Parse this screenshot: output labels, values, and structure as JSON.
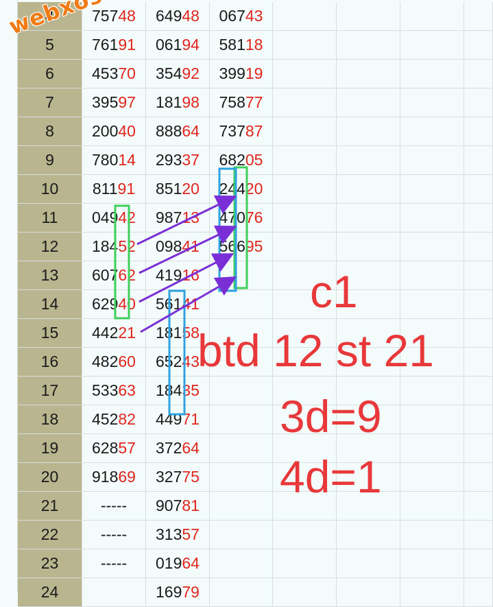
{
  "table": {
    "rows": [
      {
        "index": "4",
        "c1": "75748",
        "c2": "64948",
        "c3": "06743"
      },
      {
        "index": "5",
        "c1": "76191",
        "c2": "06194",
        "c3": "58118"
      },
      {
        "index": "6",
        "c1": "45370",
        "c2": "35492",
        "c3": "39919"
      },
      {
        "index": "7",
        "c1": "39597",
        "c2": "18198",
        "c3": "75877"
      },
      {
        "index": "8",
        "c1": "20040",
        "c2": "88864",
        "c3": "73787"
      },
      {
        "index": "9",
        "c1": "78014",
        "c2": "29337",
        "c3": "68205"
      },
      {
        "index": "10",
        "c1": "81191",
        "c2": "85120",
        "c3": "24420"
      },
      {
        "index": "11",
        "c1": "04942",
        "c2": "98713",
        "c3": "47076"
      },
      {
        "index": "12",
        "c1": "18452",
        "c2": "09841",
        "c3": "56695"
      },
      {
        "index": "13",
        "c1": "60762",
        "c2": "41916",
        "c3": ""
      },
      {
        "index": "14",
        "c1": "62940",
        "c2": "56141",
        "c3": ""
      },
      {
        "index": "15",
        "c1": "44221",
        "c2": "18158",
        "c3": ""
      },
      {
        "index": "16",
        "c1": "48260",
        "c2": "65243",
        "c3": ""
      },
      {
        "index": "17",
        "c1": "53363",
        "c2": "18435",
        "c3": ""
      },
      {
        "index": "18",
        "c1": "45282",
        "c2": "44971",
        "c3": ""
      },
      {
        "index": "19",
        "c1": "62857",
        "c2": "37264",
        "c3": ""
      },
      {
        "index": "20",
        "c1": "91869",
        "c2": "32775",
        "c3": ""
      },
      {
        "index": "21",
        "c1": "-----",
        "c2": "90781",
        "c3": ""
      },
      {
        "index": "22",
        "c1": "-----",
        "c2": "31357",
        "c3": ""
      },
      {
        "index": "23",
        "c1": "-----",
        "c2": "01964",
        "c3": ""
      },
      {
        "index": "24",
        "c1": "",
        "c2": "16979",
        "c3": ""
      }
    ]
  },
  "annotations": {
    "line1": "c1",
    "line2": "btd 12 st 21",
    "line3": "3d=9",
    "line4": "4d=1"
  },
  "watermark": "webxoso.net",
  "colors": {
    "highlight_digits": "#e0261d",
    "index_column": "#b9b58f",
    "note_text": "#e8383a",
    "green_box": "#3fcf5a",
    "blue_box": "#2ea3e0",
    "arrow": "#7a2fd6"
  }
}
